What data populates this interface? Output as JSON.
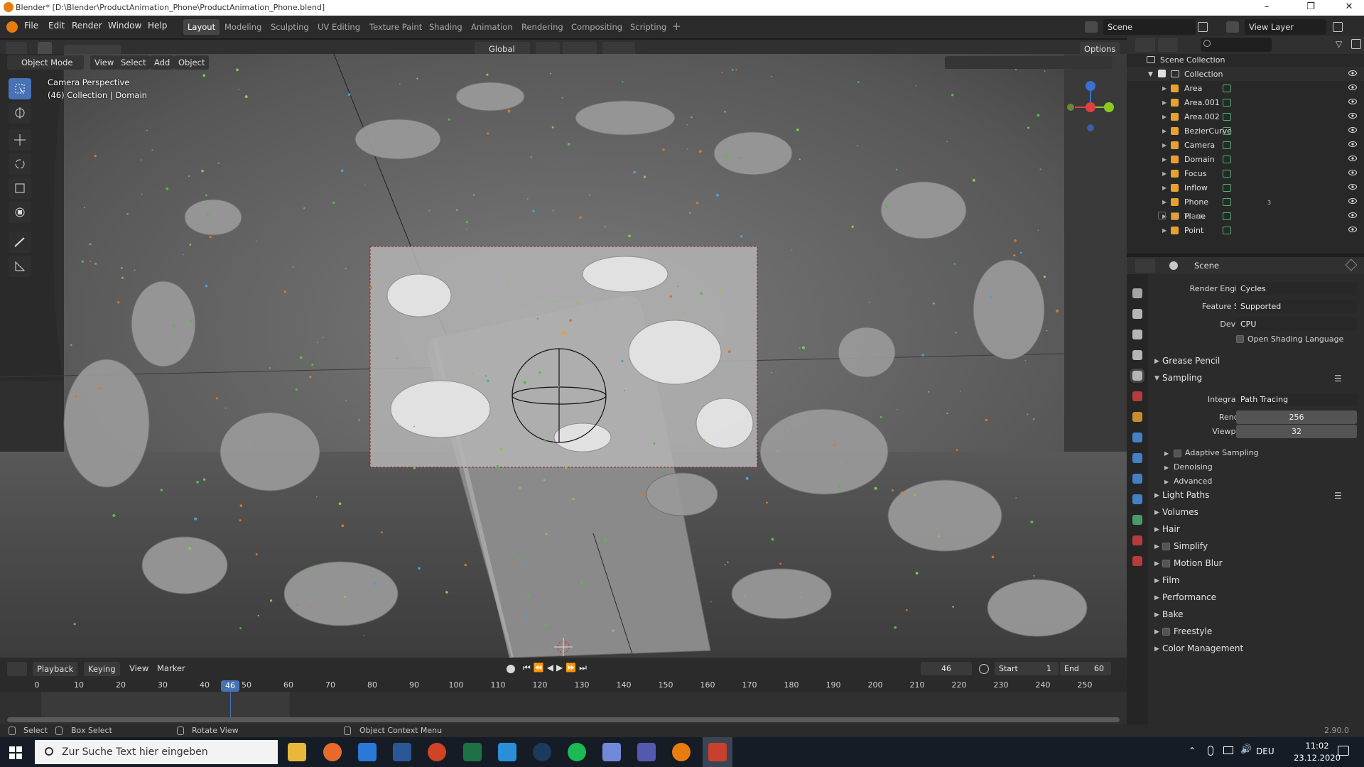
{
  "window": {
    "title": "Blender* [D:\\Blender\\ProductAnimation_Phone\\ProductAnimation_Phone.blend]"
  },
  "menu": [
    "File",
    "Edit",
    "Render",
    "Window",
    "Help"
  ],
  "workspaces": [
    "Layout",
    "Modeling",
    "Sculpting",
    "UV Editing",
    "Texture Paint",
    "Shading",
    "Animation",
    "Rendering",
    "Compositing",
    "Scripting"
  ],
  "active_workspace": "Layout",
  "scene_name": "Scene",
  "view_layer": "View Layer",
  "viewport": {
    "mode": "Object Mode",
    "menus": [
      "View",
      "Select",
      "Add",
      "Object"
    ],
    "transform_orientation": "Global",
    "options_label": "Options",
    "info_line1": "Camera Perspective",
    "info_line2": "(46) Collection | Domain"
  },
  "outliner": {
    "root": "Scene Collection",
    "collection": "Collection",
    "items": [
      "Area",
      "Area.001",
      "Area.002",
      "BezierCurve",
      "Camera",
      "Domain",
      "Focus",
      "Inflow",
      "Phone",
      "Plane",
      "Point"
    ],
    "trash": "Trash",
    "phone_badge": "3"
  },
  "properties": {
    "context": "Scene",
    "render_engine_label": "Render Engine",
    "render_engine": "Cycles",
    "feature_set_label": "Feature Set",
    "feature_set": "Supported",
    "device_label": "Device",
    "device": "CPU",
    "osl_label": "Open Shading Language",
    "grease_pencil": "Grease Pencil",
    "sampling": "Sampling",
    "integrator_label": "Integrator",
    "integrator": "Path Tracing",
    "render_label": "Render",
    "render_samples": "256",
    "viewport_label": "Viewport",
    "viewport_samples": "32",
    "sub_sections": [
      "Adaptive Sampling",
      "Denoising",
      "Advanced"
    ],
    "sections": [
      "Light Paths",
      "Volumes",
      "Hair",
      "Simplify",
      "Motion Blur",
      "Film",
      "Performance",
      "Bake",
      "Freestyle",
      "Color Management"
    ]
  },
  "timeline": {
    "menus": [
      "Playback",
      "Keying",
      "View",
      "Marker"
    ],
    "current_frame": "46",
    "start_label": "Start",
    "start": "1",
    "end_label": "End",
    "end": "60",
    "ticks": [
      "0",
      "10",
      "20",
      "30",
      "40",
      "50",
      "60",
      "70",
      "80",
      "90",
      "100",
      "110",
      "120",
      "130",
      "140",
      "150",
      "160",
      "170",
      "180",
      "190",
      "200",
      "210",
      "220",
      "230",
      "240",
      "250"
    ]
  },
  "statusbar": {
    "select": "Select",
    "box_select": "Box Select",
    "rotate_view": "Rotate View",
    "context_menu": "Object Context Menu",
    "version": "2.90.0"
  },
  "taskbar": {
    "search_placeholder": "Zur Suche Text hier eingeben",
    "language": "DEU",
    "time": "11:02",
    "date": "23.12.2020"
  },
  "colors": {
    "accent": "#4772b3",
    "orange": "#e87d0d",
    "viewport_bg": "#5f5f5f"
  }
}
